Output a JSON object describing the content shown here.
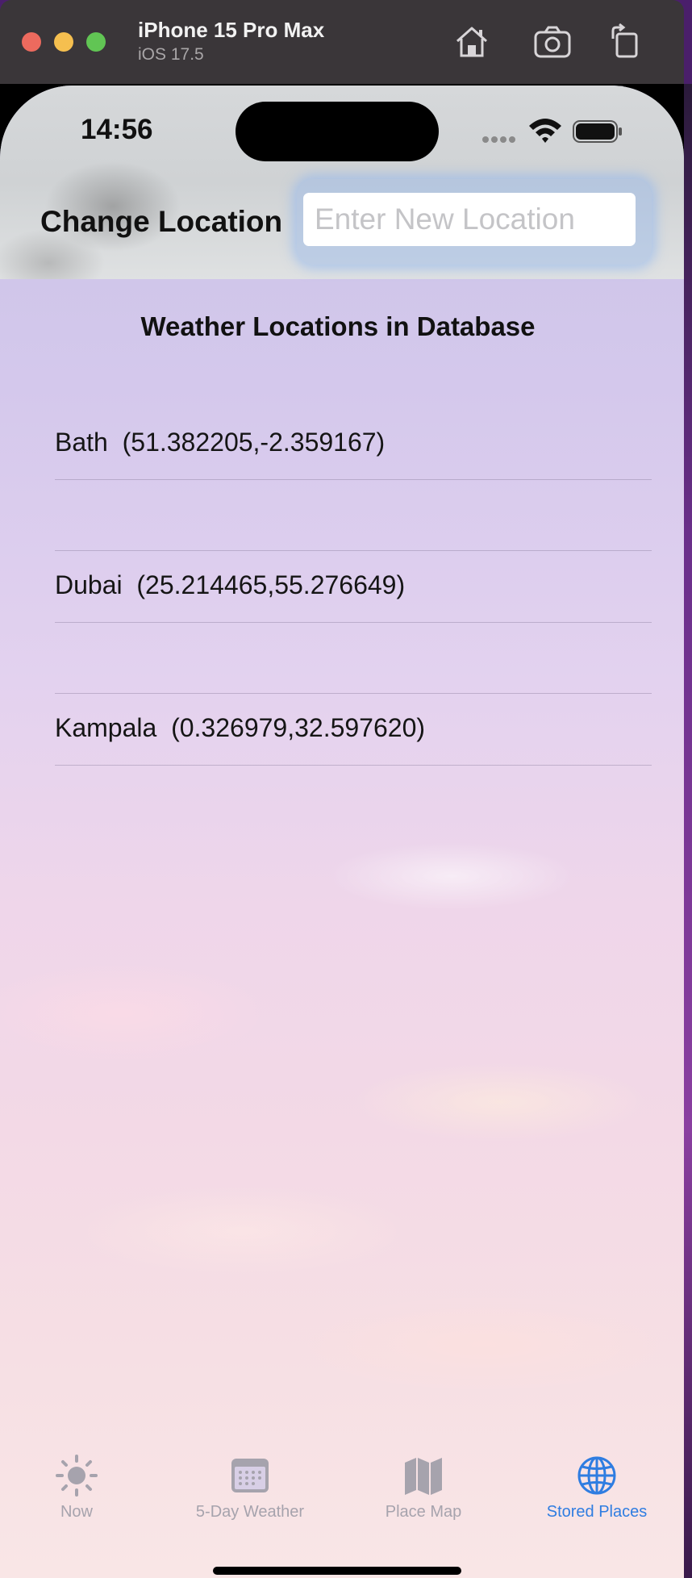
{
  "simulator": {
    "device_name": "iPhone 15 Pro Max",
    "os_version": "iOS 17.5",
    "buttons": [
      "home-icon",
      "screenshot-icon",
      "rotate-icon"
    ]
  },
  "status_bar": {
    "time": "14:56"
  },
  "header": {
    "change_label": "Change Location",
    "location_input": {
      "value": "",
      "placeholder": "Enter New Location"
    }
  },
  "main": {
    "title": "Weather Locations in Database",
    "locations": [
      {
        "label": "Bath  (51.382205,-2.359167)"
      },
      {
        "label": "Dubai  (25.214465,55.276649)"
      },
      {
        "label": "Kampala  (0.326979,32.597620)"
      }
    ]
  },
  "tab_bar": {
    "tabs": [
      {
        "label": "Now",
        "icon": "sun-icon",
        "active": false
      },
      {
        "label": "5-Day Weather",
        "icon": "calendar-icon",
        "active": false
      },
      {
        "label": "Place Map",
        "icon": "map-icon",
        "active": false
      },
      {
        "label": "Stored Places",
        "icon": "globe-icon",
        "active": true
      }
    ]
  },
  "colors": {
    "accent": "#2f7de1",
    "inactive_tab": "#a6a3ad",
    "sim_bar": "#3a3639"
  }
}
